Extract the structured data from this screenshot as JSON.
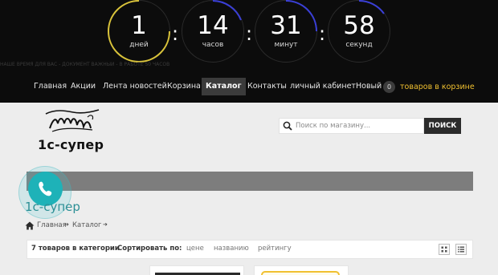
{
  "countdown": {
    "days": {
      "value": "1",
      "label": "дней"
    },
    "hours": {
      "value": "14",
      "label": "часов"
    },
    "minutes": {
      "value": "31",
      "label": "минут"
    },
    "seconds": {
      "value": "58",
      "label": "секунд"
    },
    "separator": ":",
    "ticker_text": "НАШЕ ВРЕМЯ ДЛЯ ВАС - ДОКУМЕНТ ВАЖНЫЙ - В РАБОТЕ 50 ЧАСОВ",
    "colors": {
      "arc": "#3a3fd8",
      "arc_days": "#d9c33a",
      "background": "#0c0c0c"
    }
  },
  "nav": {
    "items": [
      {
        "label": "Главная"
      },
      {
        "label": "Акции"
      },
      {
        "label": "Лента новостей"
      },
      {
        "label": "Корзина"
      },
      {
        "label": "Каталог",
        "active": true
      },
      {
        "label": "Контакты"
      },
      {
        "label": "личный кабинет"
      },
      {
        "label": "Новый"
      }
    ],
    "cart_count": "0",
    "cart_text": "товаров в корзине",
    "cart_color": "#f0c030"
  },
  "header": {
    "logo_text": "1с-супер",
    "logo_icon": "calligraphy-monogram-icon",
    "search_placeholder": "Поиск по магазину...",
    "search_button": "ПОИСК"
  },
  "page": {
    "title": "1с-супер",
    "title_color": "#2c8f95",
    "breadcrumbs": [
      "Главная",
      "Каталог"
    ],
    "phone_color": "#1eb2b8"
  },
  "catalog_toolbar": {
    "count_text": "7 товаров в категории",
    "sort_label": "Сортировать по:",
    "sort_options": [
      "цене",
      "названию",
      "рейтингу"
    ],
    "view_modes": [
      "grid-view-icon",
      "list-view-icon"
    ]
  }
}
